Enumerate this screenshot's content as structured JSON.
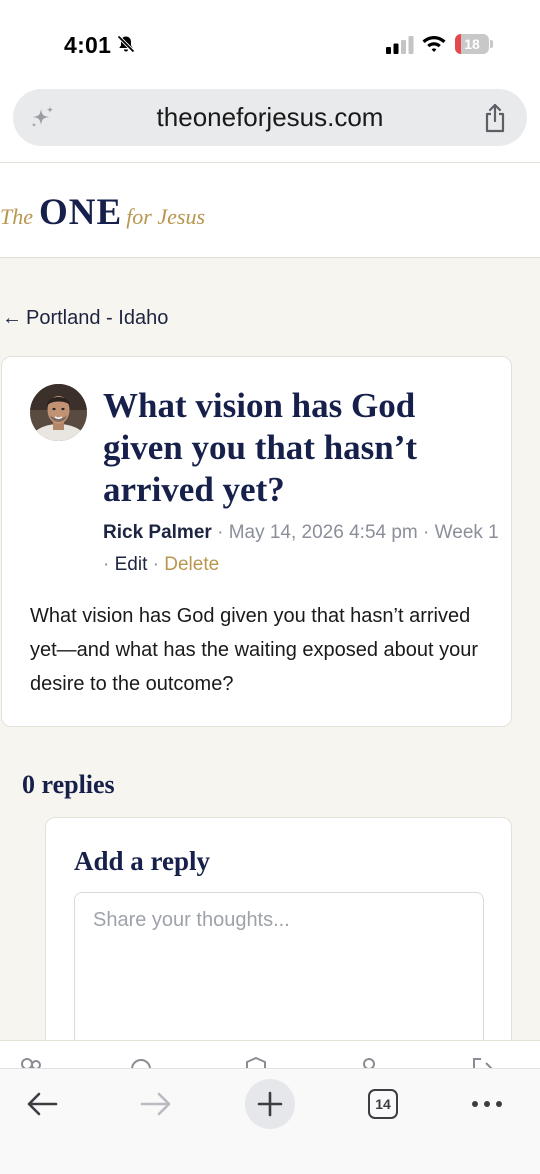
{
  "status_bar": {
    "time": "4:01",
    "battery": "18",
    "battery_level": 0.18,
    "battery_color": "#e5484d"
  },
  "browser": {
    "url": "theoneforjesus.com",
    "tab_count": "14",
    "icons": [
      "sparkle-icon",
      "share-icon",
      "back-arrow-icon",
      "forward-arrow-icon",
      "plus-icon",
      "tabs-icon",
      "more-icon"
    ]
  },
  "site": {
    "logo": {
      "the": "The",
      "one": "ONE",
      "for_jesus": "for Jesus"
    },
    "accent_color": "#b8964f",
    "navy_color": "#16204a",
    "background_color": "#f7f5f0"
  },
  "breadcrumb": {
    "arrow": "←",
    "label": "Portland - Idaho"
  },
  "post": {
    "title": "What vision has God given you that hasn’t arrived yet?",
    "author": "Rick Palmer",
    "sep": "·",
    "date": "May 14, 2026 4:54 pm",
    "week": "Week 1",
    "edit": "Edit",
    "delete": "Delete",
    "body": "What vision has God given you that hasn’t arrived yet—and what has the waiting exposed about your desire to the outcome?"
  },
  "replies": {
    "count_label": "0 replies",
    "form": {
      "heading": "Add a reply",
      "placeholder": "Share your thoughts...",
      "value": ""
    }
  }
}
